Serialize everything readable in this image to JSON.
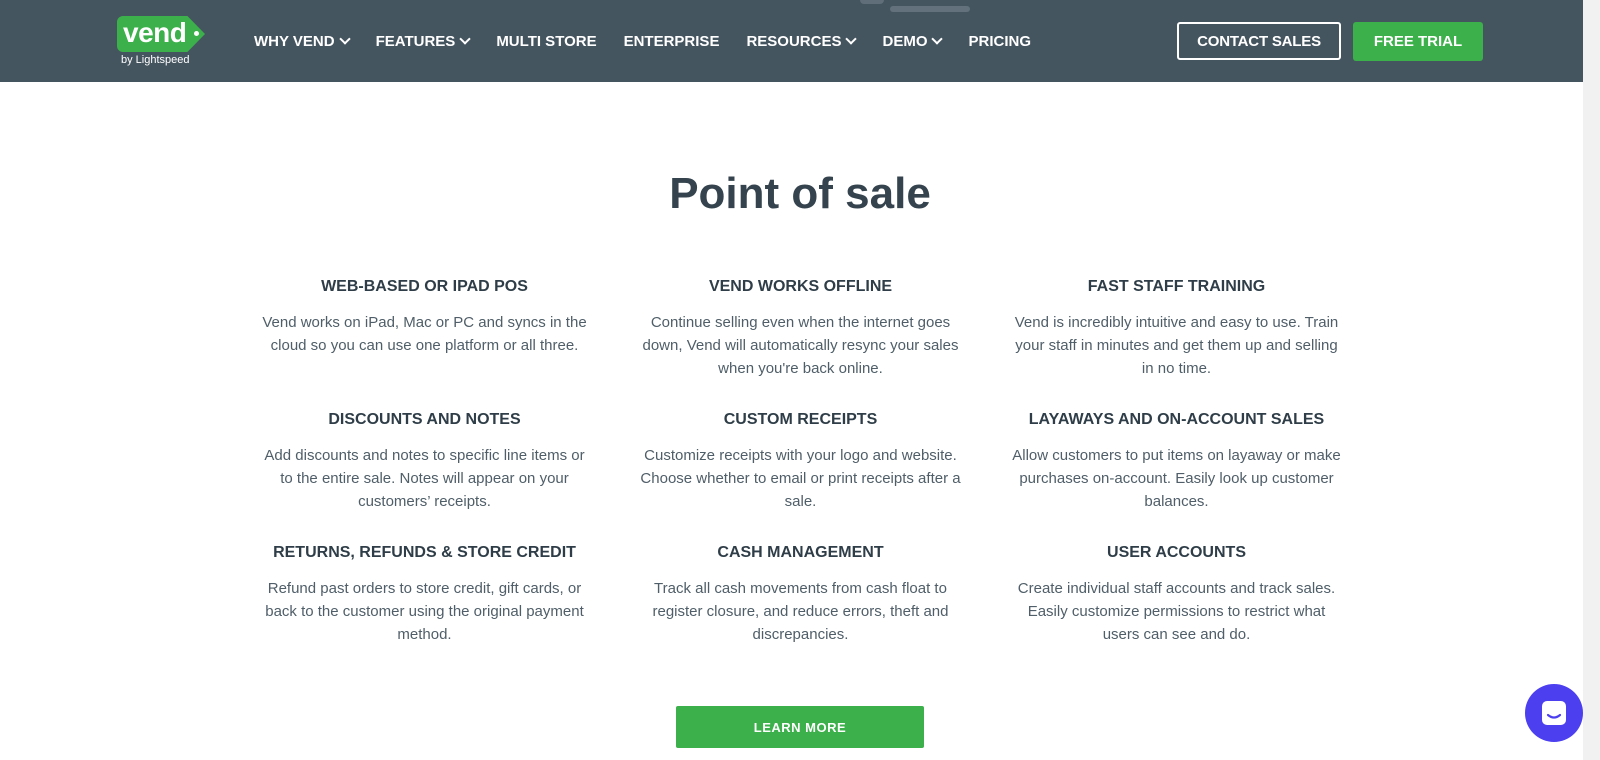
{
  "brand": {
    "logo_text": "vend",
    "logo_sub": "by Lightspeed"
  },
  "nav": {
    "items": [
      {
        "label": "WHY VEND",
        "has_dropdown": true
      },
      {
        "label": "FEATURES",
        "has_dropdown": true
      },
      {
        "label": "MULTI STORE",
        "has_dropdown": false
      },
      {
        "label": "ENTERPRISE",
        "has_dropdown": false
      },
      {
        "label": "RESOURCES",
        "has_dropdown": true
      },
      {
        "label": "DEMO",
        "has_dropdown": true
      },
      {
        "label": "PRICING",
        "has_dropdown": false
      }
    ]
  },
  "header": {
    "contact_label": "CONTACT SALES",
    "trial_label": "FREE TRIAL"
  },
  "main": {
    "title": "Point of sale",
    "features": [
      {
        "title": "WEB-BASED OR IPAD POS",
        "desc": "Vend works on iPad, Mac or PC and syncs in the cloud so you can use one platform or all three."
      },
      {
        "title": "VEND WORKS OFFLINE",
        "desc": "Continue selling even when the internet goes down, Vend will automatically resync your sales when you're back online."
      },
      {
        "title": "FAST STAFF TRAINING",
        "desc": "Vend is incredibly intuitive and easy to use. Train your staff in minutes and get them up and selling in no time."
      },
      {
        "title": "DISCOUNTS AND NOTES",
        "desc": "Add discounts and notes to specific line items or to the entire sale. Notes will appear on your customers’ receipts."
      },
      {
        "title": "CUSTOM RECEIPTS",
        "desc": "Customize receipts with your logo and website. Choose whether to email or print receipts after a sale."
      },
      {
        "title": "LAYAWAYS AND ON-ACCOUNT SALES",
        "desc": "Allow customers to put items on layaway or make purchases on-account. Easily look up customer balances."
      },
      {
        "title": "RETURNS, REFUNDS & STORE CREDIT",
        "desc": "Refund past orders to store credit, gift cards, or back to the customer using the original payment method."
      },
      {
        "title": "CASH MANAGEMENT",
        "desc": "Track all cash movements from cash float to register closure, and reduce errors, theft and discrepancies."
      },
      {
        "title": "USER ACCOUNTS",
        "desc": "Create individual staff accounts and track sales. Easily customize permissions to restrict what users can see and do."
      }
    ],
    "cta_label": "LEARN MORE"
  },
  "chat": {
    "icon": "chat-bubble-icon"
  },
  "colors": {
    "header_bg": "#455560",
    "brand_green": "#3cb04a",
    "heading": "#34434d",
    "body_text": "#4f5e68",
    "chat_purple": "#4b3ff0"
  }
}
